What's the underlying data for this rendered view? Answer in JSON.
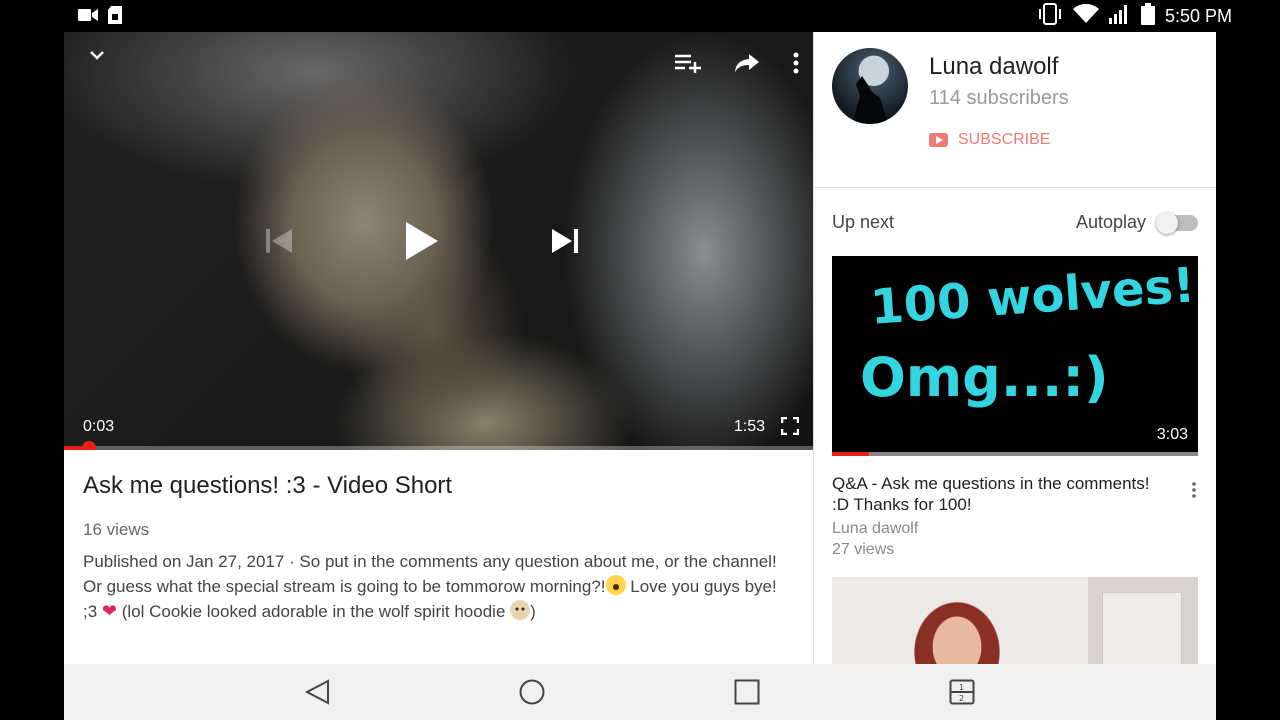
{
  "status_bar": {
    "time": "5:50 PM",
    "icons": [
      "video-camera-icon",
      "sim-icon",
      "vibrate-icon",
      "wifi-icon",
      "signal-icon",
      "battery-icon"
    ]
  },
  "player": {
    "current_time": "0:03",
    "duration": "1:53",
    "progress_fraction": 0.033,
    "top_icons": [
      "chevron-down-icon",
      "add-to-playlist-icon",
      "share-icon",
      "more-vert-icon"
    ],
    "center_icons": [
      "skip-previous-icon",
      "play-icon",
      "skip-next-icon"
    ]
  },
  "video": {
    "title": "Ask me questions! :3 - Video Short",
    "views": "16 views",
    "description_line1": "Published on Jan 27, 2017 · So put in the comments any question about me, or the channel!",
    "description_line2a": "Or guess what the special stream is going to be tommorow morning?!",
    "description_line2b": " Love you guys bye! ;3 ",
    "description_line2c": " (lol Cookie looked adorable in the wolf spirit hoodie ",
    "description_line2d": ")"
  },
  "channel": {
    "name": "Luna dawolf",
    "subscribers": "114 subscribers",
    "subscribe_label": "SUBSCRIBE"
  },
  "up_next": {
    "label": "Up next",
    "autoplay_label": "Autoplay",
    "autoplay_on": false
  },
  "related": [
    {
      "thumb_text_line1": "100 wolves!",
      "thumb_text_line2": "Omg...:)",
      "duration": "3:03",
      "watched_fraction": 0.1,
      "title": "Q&A - Ask me questions in the comments! :D Thanks for 100!",
      "channel": "Luna dawolf",
      "views": "27 views"
    }
  ],
  "colors": {
    "accent": "#e62117",
    "thumb_text": "#33d6e0",
    "nav_bg": "#f0f0f0"
  }
}
